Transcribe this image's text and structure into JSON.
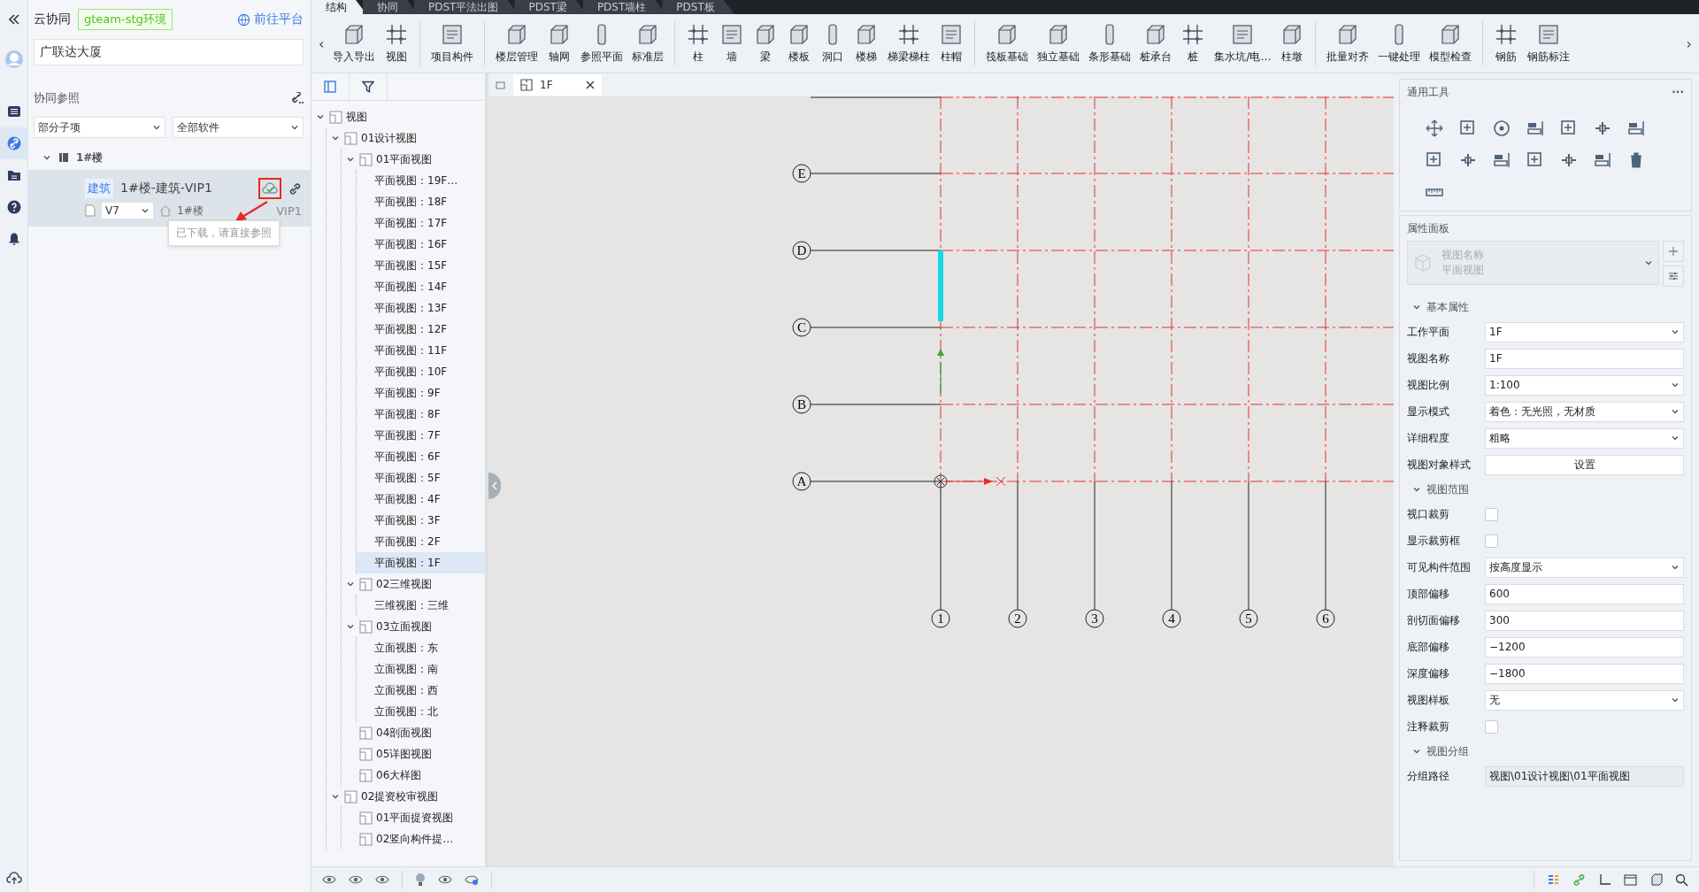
{
  "rail": [
    {
      "selected": false
    },
    {
      "selected": true
    },
    {
      "selected": false
    },
    {
      "selected": false
    },
    {
      "selected": false
    }
  ],
  "sidebar": {
    "title": "云协同",
    "env_badge": "gteam-stg环境",
    "platform_link": "前往平台",
    "search": {
      "value": "广联达大厦"
    },
    "section_title": "协同参照",
    "filters": [
      {
        "value": "部分子项"
      },
      {
        "value": "全部软件"
      }
    ],
    "groups": [
      {
        "label": "1#楼",
        "expanded": true,
        "items": [
          {
            "tag": "建筑",
            "name": "1#楼-建筑-VIP1",
            "selected": true,
            "version": "V7",
            "building": "1#楼",
            "suffix": "VIP1",
            "downloaded": true
          }
        ]
      }
    ],
    "tooltip": "已下载，请直接参照"
  },
  "ribbon": {
    "tabs": [
      {
        "label": "结构",
        "selected": true
      },
      {
        "label": "协同",
        "selected": false
      },
      {
        "label": "PDST平法出图",
        "selected": false
      },
      {
        "label": "PDST梁",
        "selected": false
      },
      {
        "label": "PDST墙柱",
        "selected": false
      },
      {
        "label": "PDST板",
        "selected": false
      }
    ],
    "scroll_left": "‹",
    "scroll_right": "›",
    "groups": [
      {
        "tools": [
          "导入导出",
          "视图"
        ]
      },
      {
        "tools": [
          "项目构件"
        ]
      },
      {
        "tools": [
          "楼层管理",
          "轴网",
          "参照平面",
          "标准层"
        ]
      },
      {
        "tools": [
          "柱",
          "墙",
          "梁",
          "楼板",
          "洞口",
          "楼梯",
          "梯梁梯柱",
          "柱帽"
        ]
      },
      {
        "tools": [
          "筏板基础",
          "独立基础",
          "条形基础",
          "桩承台",
          "桩",
          "集水坑/电…",
          "柱墩"
        ]
      },
      {
        "tools": [
          "批量对齐",
          "一键处理",
          "模型检查"
        ]
      },
      {
        "tools": [
          "钢筋",
          "钢筋标注"
        ]
      }
    ]
  },
  "tree": {
    "nodes": [
      {
        "label": "视图",
        "kind": "group",
        "expanded": true,
        "selected": false,
        "children": [
          {
            "label": "01设计视图",
            "kind": "group",
            "expanded": true,
            "selected": false,
            "children": [
              {
                "label": "01平面视图",
                "kind": "group",
                "expanded": true,
                "selected": false,
                "children": [
                  {
                    "label": "平面视图：19F…",
                    "selected": false
                  },
                  {
                    "label": "平面视图：18F",
                    "selected": false
                  },
                  {
                    "label": "平面视图：17F",
                    "selected": false
                  },
                  {
                    "label": "平面视图：16F",
                    "selected": false
                  },
                  {
                    "label": "平面视图：15F",
                    "selected": false
                  },
                  {
                    "label": "平面视图：14F",
                    "selected": false
                  },
                  {
                    "label": "平面视图：13F",
                    "selected": false
                  },
                  {
                    "label": "平面视图：12F",
                    "selected": false
                  },
                  {
                    "label": "平面视图：11F",
                    "selected": false
                  },
                  {
                    "label": "平面视图：10F",
                    "selected": false
                  },
                  {
                    "label": "平面视图：9F",
                    "selected": false
                  },
                  {
                    "label": "平面视图：8F",
                    "selected": false
                  },
                  {
                    "label": "平面视图：7F",
                    "selected": false
                  },
                  {
                    "label": "平面视图：6F",
                    "selected": false
                  },
                  {
                    "label": "平面视图：5F",
                    "selected": false
                  },
                  {
                    "label": "平面视图：4F",
                    "selected": false
                  },
                  {
                    "label": "平面视图：3F",
                    "selected": false
                  },
                  {
                    "label": "平面视图：2F",
                    "selected": false
                  },
                  {
                    "label": "平面视图：1F",
                    "selected": true
                  }
                ]
              },
              {
                "label": "02三维视图",
                "kind": "group",
                "expanded": true,
                "selected": false,
                "children": [
                  {
                    "label": "三维视图：三维",
                    "selected": false
                  }
                ]
              },
              {
                "label": "03立面视图",
                "kind": "group",
                "expanded": true,
                "selected": false,
                "children": [
                  {
                    "label": "立面视图：东",
                    "selected": false
                  },
                  {
                    "label": "立面视图：南",
                    "selected": false
                  },
                  {
                    "label": "立面视图：西",
                    "selected": false
                  },
                  {
                    "label": "立面视图：北",
                    "selected": false
                  }
                ]
              },
              {
                "label": "04剖面视图",
                "kind": "group",
                "selected": false
              },
              {
                "label": "05详图视图",
                "kind": "group",
                "selected": false
              },
              {
                "label": "06大样图",
                "kind": "group",
                "selected": false
              }
            ]
          },
          {
            "label": "02提资校审视图",
            "kind": "group",
            "expanded": true,
            "selected": false,
            "children": [
              {
                "label": "01平面提资视图",
                "kind": "group",
                "selected": false
              },
              {
                "label": "02竖向构件提…",
                "kind": "group",
                "selected": false
              }
            ]
          }
        ]
      }
    ]
  },
  "canvas": {
    "tab": {
      "label": "1F"
    },
    "rows": [
      "E",
      "D",
      "C",
      "B",
      "A"
    ],
    "columns": [
      "1",
      "2",
      "3",
      "4",
      "5",
      "6"
    ]
  },
  "general_tools": {
    "title": "通用工具",
    "more": "···"
  },
  "properties": {
    "title": "属性面板",
    "type": {
      "name": "视图名称",
      "value": "平面视图"
    },
    "sections": [
      {
        "title": "基本属性",
        "expanded": true,
        "rows": [
          {
            "label": "工作平面",
            "kind": "select",
            "value": "1F"
          },
          {
            "label": "视图名称",
            "kind": "input",
            "value": "1F"
          },
          {
            "label": "视图比例",
            "kind": "select",
            "value": "1:100"
          },
          {
            "label": "显示模式",
            "kind": "select",
            "value": "着色：无光照，无材质"
          },
          {
            "label": "详细程度",
            "kind": "select",
            "value": "粗略"
          },
          {
            "label": "视图对象样式",
            "kind": "button",
            "value": "设置"
          }
        ]
      },
      {
        "title": "视图范围",
        "expanded": true,
        "rows": [
          {
            "label": "视口裁剪",
            "kind": "checkbox",
            "checked": false
          },
          {
            "label": "显示裁剪框",
            "kind": "checkbox",
            "checked": false
          },
          {
            "label": "可见构件范围",
            "kind": "select",
            "value": "按高度显示"
          },
          {
            "label": "顶部偏移",
            "kind": "input",
            "value": "600"
          },
          {
            "label": "剖切面偏移",
            "kind": "input",
            "value": "300"
          },
          {
            "label": "底部偏移",
            "kind": "input",
            "value": "−1200"
          },
          {
            "label": "深度偏移",
            "kind": "input",
            "value": "−1800"
          },
          {
            "label": "视图样板",
            "kind": "select",
            "value": "无"
          },
          {
            "label": "注释裁剪",
            "kind": "checkbox",
            "checked": false
          }
        ]
      },
      {
        "title": "视图分组",
        "expanded": true,
        "rows": [
          {
            "label": "分组路径",
            "kind": "readonly",
            "value": "视图\\01设计视图\\01平面视图"
          }
        ]
      }
    ]
  }
}
